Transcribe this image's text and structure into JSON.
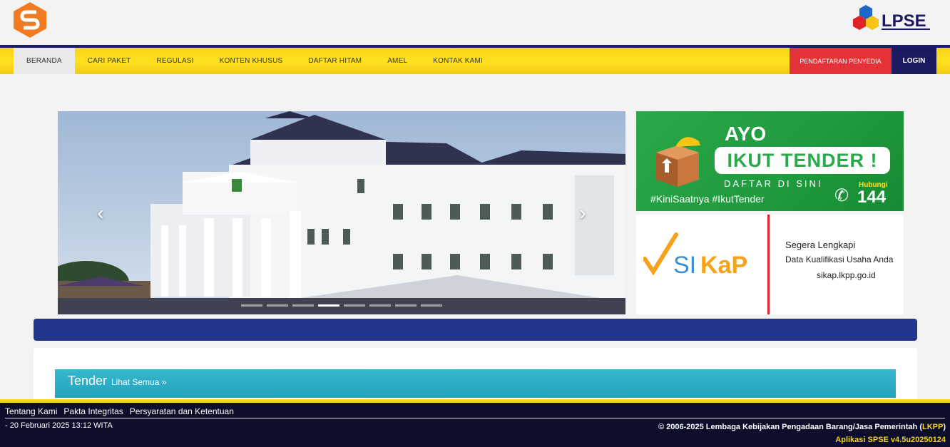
{
  "nav": {
    "items": [
      {
        "label": "BERANDA",
        "active": true
      },
      {
        "label": "CARI PAKET"
      },
      {
        "label": "REGULASI"
      },
      {
        "label": "KONTEN KHUSUS"
      },
      {
        "label": "DAFTAR HITAM"
      },
      {
        "label": "AMEL"
      },
      {
        "label": "KONTAK KAMI"
      }
    ],
    "register_label": "PENDAFTARAN PENYEDIA",
    "login_label": "LOGIN"
  },
  "header": {
    "right_logo_text": "LPSE"
  },
  "carousel": {
    "prev_icon": "chevron-left-icon",
    "next_icon": "chevron-right-icon",
    "slide_count": 8,
    "active_index": 3
  },
  "banner_tender": {
    "ayo": "AYO",
    "ikut": "IKUT TENDER !",
    "daftar": "DAFTAR DI SINI",
    "hashtag": "#KiniSaatnya #IkutTender",
    "hubungi": "Hubungi",
    "number": "144"
  },
  "banner_sikap": {
    "logo_text": "SIKaP",
    "line1": "Segera Lengkapi",
    "line2": "Data Kualifikasi Usaha Anda",
    "line3": "sikap.lkpp.go.id"
  },
  "tender": {
    "title": "Tender",
    "link": "Lihat Semua »"
  },
  "footer": {
    "links": [
      "Tentang Kami",
      "Pakta Integritas",
      "Persyaratan dan Ketentuan"
    ],
    "date": "- 20 Februari 2025 13:12 WITA",
    "copyright_prefix": "© 2006-2025 Lembaga Kebijakan Pengadaan Barang/Jasa Pemerintah (",
    "copyright_lkpp": "LKPP",
    "copyright_suffix": ")",
    "version": "Aplikasi SPSE v4.5u20250124"
  },
  "colors": {
    "nav_yellow": "#ffe21f",
    "register_red": "#e53238",
    "login_navy": "#1a1a60",
    "tender_teal": "#24a3be",
    "footer_bg": "#0c0c2b"
  }
}
